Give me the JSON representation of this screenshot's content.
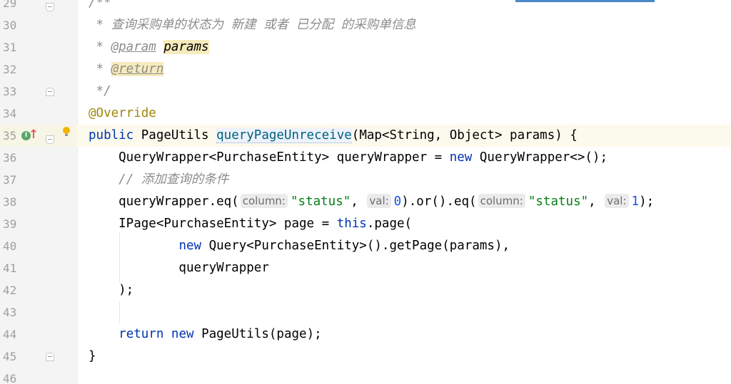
{
  "editor": {
    "lines": [
      {
        "number": "29",
        "tokens": [
          {
            "cls": "cmt",
            "text": "/**"
          }
        ]
      },
      {
        "number": "30",
        "tokens": [
          {
            "cls": "cmt",
            "text": " * 查询采购单的状态为 新建 或者 已分配 的采购单信息"
          }
        ]
      },
      {
        "number": "31",
        "tokens": [
          {
            "cls": "cmt",
            "text": " * "
          },
          {
            "cls": "tag",
            "text": "@param"
          },
          {
            "cls": "cmt",
            "text": " "
          },
          {
            "cls": "param-hl",
            "text": "params"
          }
        ]
      },
      {
        "number": "32",
        "tokens": [
          {
            "cls": "cmt",
            "text": " * "
          },
          {
            "cls": "tag tag-hl",
            "text": "@return"
          }
        ]
      },
      {
        "number": "33",
        "tokens": [
          {
            "cls": "cmt",
            "text": " */"
          }
        ]
      },
      {
        "number": "34",
        "tokens": [
          {
            "cls": "ann",
            "text": "@Override"
          }
        ]
      },
      {
        "number": "35",
        "tokens": [
          {
            "cls": "kw",
            "text": "public"
          },
          {
            "cls": "",
            "text": " PageUtils "
          },
          {
            "cls": "method-hl",
            "text": "queryPageUnreceive"
          },
          {
            "cls": "",
            "text": "(Map<String, Object> params) {"
          }
        ]
      },
      {
        "number": "36",
        "tokens": [
          {
            "cls": "",
            "text": "    QueryWrapper<PurchaseEntity> queryWrapper = "
          },
          {
            "cls": "kw",
            "text": "new"
          },
          {
            "cls": "",
            "text": " QueryWrapper<>();"
          }
        ]
      },
      {
        "number": "37",
        "tokens": [
          {
            "cls": "",
            "text": "    "
          },
          {
            "cls": "cmt",
            "text": "// 添加查询的条件"
          }
        ]
      },
      {
        "number": "38",
        "tokens": [
          {
            "cls": "",
            "text": "    queryWrapper.eq("
          },
          {
            "cls": "hint",
            "text": "column:"
          },
          {
            "cls": "str",
            "text": "\"status\""
          },
          {
            "cls": "",
            "text": ", "
          },
          {
            "cls": "hint",
            "text": "val:"
          },
          {
            "cls": "num",
            "text": "0"
          },
          {
            "cls": "",
            "text": ").or().eq("
          },
          {
            "cls": "hint",
            "text": "column:"
          },
          {
            "cls": "str",
            "text": "\"status\""
          },
          {
            "cls": "",
            "text": ", "
          },
          {
            "cls": "hint",
            "text": "val:"
          },
          {
            "cls": "num",
            "text": "1"
          },
          {
            "cls": "",
            "text": ");"
          }
        ]
      },
      {
        "number": "39",
        "tokens": [
          {
            "cls": "",
            "text": "    IPage<PurchaseEntity> page = "
          },
          {
            "cls": "kw",
            "text": "this"
          },
          {
            "cls": "",
            "text": ".page("
          }
        ]
      },
      {
        "number": "40",
        "tokens": [
          {
            "cls": "",
            "text": "            "
          },
          {
            "cls": "kw",
            "text": "new"
          },
          {
            "cls": "",
            "text": " Query<PurchaseEntity>().getPage(params),"
          }
        ]
      },
      {
        "number": "41",
        "tokens": [
          {
            "cls": "",
            "text": "            queryWrapper"
          }
        ]
      },
      {
        "number": "42",
        "tokens": [
          {
            "cls": "",
            "text": "    );"
          }
        ]
      },
      {
        "number": "43",
        "tokens": []
      },
      {
        "number": "44",
        "tokens": [
          {
            "cls": "",
            "text": "    "
          },
          {
            "cls": "kw",
            "text": "return"
          },
          {
            "cls": "",
            "text": " "
          },
          {
            "cls": "kw",
            "text": "new"
          },
          {
            "cls": "",
            "text": " PageUtils(page);"
          }
        ]
      },
      {
        "number": "45",
        "tokens": [
          {
            "cls": "",
            "text": "}"
          }
        ]
      },
      {
        "number": "46",
        "tokens": []
      }
    ],
    "current_line": "35"
  },
  "colors": {
    "keyword": "#0033b3",
    "annotation": "#9e880d",
    "string": "#067d17",
    "number": "#1750eb",
    "comment": "#8c8c8c",
    "method": "#00627a",
    "current_line_bg": "#fcfaed"
  },
  "gutter_icons": {
    "line_35": [
      "implementing-method-icon",
      "override-up-arrow-icon",
      "intention-bulb-icon"
    ]
  }
}
